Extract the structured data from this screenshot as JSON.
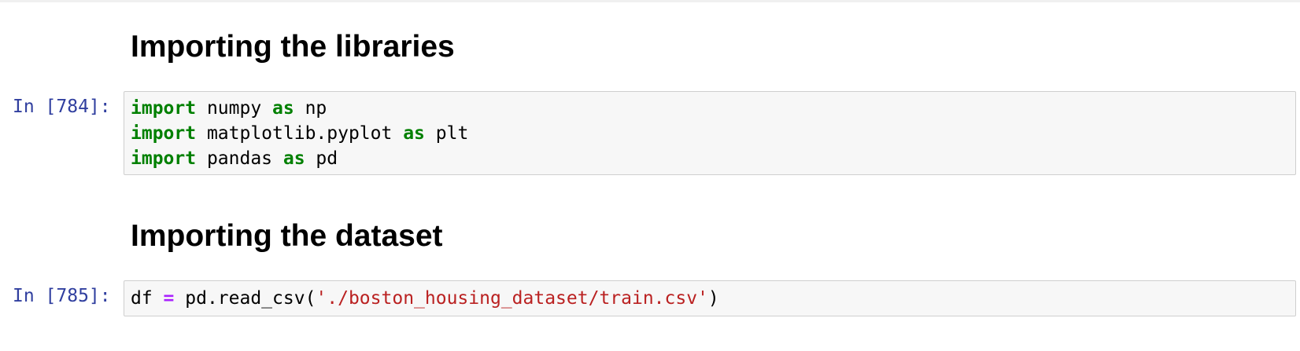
{
  "cells": [
    {
      "type": "markdown",
      "heading": "Importing the libraries"
    },
    {
      "type": "code",
      "prompt": "In [784]:",
      "lines": [
        {
          "kw1": "import",
          "mod": " numpy ",
          "kw2": "as",
          "alias": " np"
        },
        {
          "kw1": "import",
          "mod": " matplotlib.pyplot ",
          "kw2": "as",
          "alias": " plt"
        },
        {
          "kw1": "import",
          "mod": " pandas ",
          "kw2": "as",
          "alias": " pd"
        }
      ]
    },
    {
      "type": "markdown",
      "heading": "Importing the dataset"
    },
    {
      "type": "code",
      "prompt": "In [785]:",
      "line": {
        "var": "df ",
        "op": "=",
        "call": " pd.read_csv(",
        "str": "'./boston_housing_dataset/train.csv'",
        "close": ")"
      }
    }
  ],
  "syntax_colors": {
    "keyword": "#008000",
    "operator": "#aa22ff",
    "string": "#ba2121",
    "prompt": "#303f9f"
  }
}
